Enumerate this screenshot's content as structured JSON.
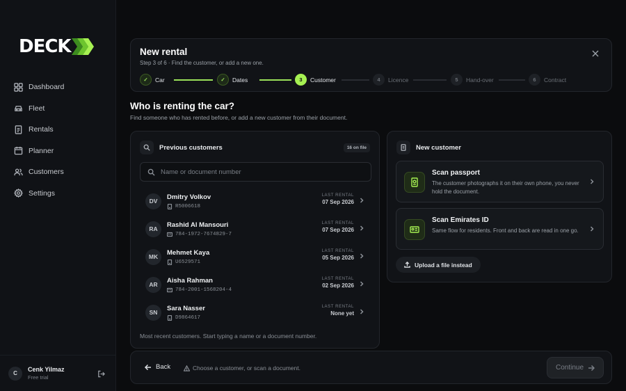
{
  "brand": {
    "logo_text": "DECK",
    "accent": "#a6f152"
  },
  "sidebar": {
    "items": [
      {
        "label": "Dashboard",
        "icon": "grid-icon"
      },
      {
        "label": "Fleet",
        "icon": "car-icon"
      },
      {
        "label": "Rentals",
        "icon": "document-icon"
      },
      {
        "label": "Planner",
        "icon": "calendar-icon"
      },
      {
        "label": "Customers",
        "icon": "users-icon"
      },
      {
        "label": "Settings",
        "icon": "gear-icon"
      }
    ],
    "user": {
      "initial": "C",
      "name": "Cenk Yilmaz",
      "plan": "Free trial"
    }
  },
  "header": {
    "title": "New rental",
    "subtitle": "Step 3 of 6 · Find the customer, or add a new one.",
    "steps": [
      {
        "num": "1",
        "label": "Car",
        "state": "done"
      },
      {
        "num": "2",
        "label": "Dates",
        "state": "done"
      },
      {
        "num": "3",
        "label": "Customer",
        "state": "current"
      },
      {
        "num": "4",
        "label": "Licence",
        "state": "todo"
      },
      {
        "num": "5",
        "label": "Hand-over",
        "state": "todo"
      },
      {
        "num": "6",
        "label": "Contract",
        "state": "todo"
      }
    ]
  },
  "question": {
    "title": "Who is renting the car?",
    "subtitle": "Find someone who has rented before, or add a new customer from their document."
  },
  "previous": {
    "title": "Previous customers",
    "badge": "16 on file",
    "search_placeholder": "Name or document number",
    "last_rental_label": "LAST RENTAL",
    "customers": [
      {
        "initials": "DV",
        "name": "Dmitry Volkov",
        "doc": "R5006618",
        "doc_icon": "passport-icon",
        "last": "07 Sep 2026"
      },
      {
        "initials": "RA",
        "name": "Rashid Al Mansouri",
        "doc": "784-1972-7674829-7",
        "doc_icon": "id-card-icon",
        "last": "07 Sep 2026"
      },
      {
        "initials": "MK",
        "name": "Mehmet Kaya",
        "doc": "U6529571",
        "doc_icon": "passport-icon",
        "last": "05 Sep 2026"
      },
      {
        "initials": "AR",
        "name": "Aisha Rahman",
        "doc": "784-2001-1568204-4",
        "doc_icon": "id-card-icon",
        "last": "02 Sep 2026"
      },
      {
        "initials": "SN",
        "name": "Sara Nasser",
        "doc": "D9864617",
        "doc_icon": "passport-icon",
        "last": "None yet"
      }
    ],
    "footer": "Most recent customers. Start typing a name or a document number."
  },
  "new_customer": {
    "title": "New customer",
    "options": [
      {
        "title": "Scan passport",
        "desc": "The customer photographs it on their own phone, you never hold the document."
      },
      {
        "title": "Scan Emirates ID",
        "desc": "Same flow for residents. Front and back are read in one go."
      }
    ],
    "upload_label": "Upload a file instead"
  },
  "footer": {
    "back": "Back",
    "hint": "Choose a customer, or scan a document.",
    "continue": "Continue"
  }
}
